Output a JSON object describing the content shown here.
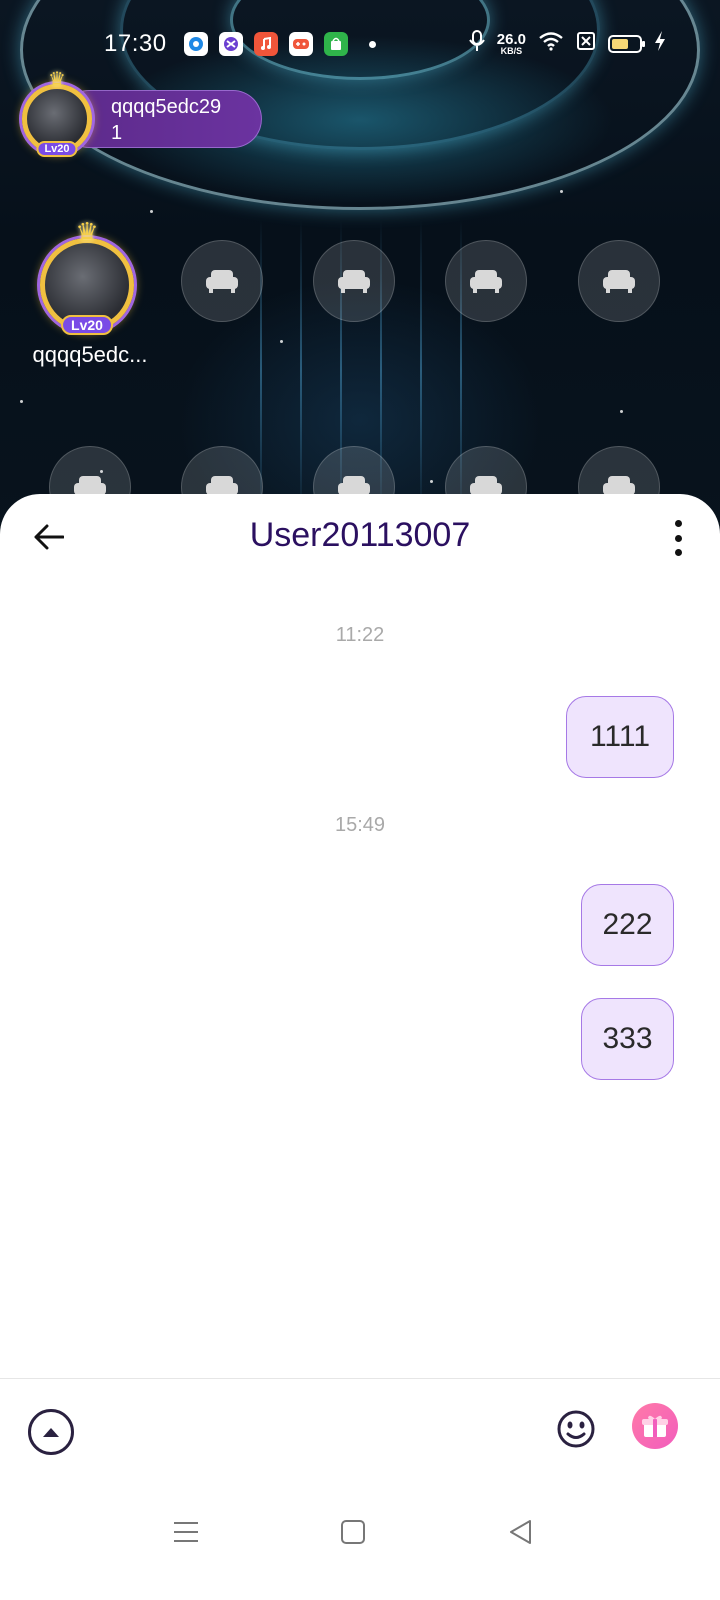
{
  "status_bar": {
    "time": "17:30",
    "net_speed_value": "26.0",
    "net_speed_unit": "KB/S",
    "app_icons": [
      "location-app-icon",
      "browser-app-icon",
      "music-app-icon",
      "game-app-icon",
      "store-app-icon"
    ],
    "system_icons": [
      "microphone-icon",
      "wifi-icon",
      "sim-off-icon",
      "battery-icon",
      "charging-icon"
    ]
  },
  "room": {
    "host_name": "qqqq5edc29",
    "host_count": "1",
    "host_level": "Lv20",
    "seat_owner_name": "qqqq5edc...",
    "seat_owner_level": "Lv20"
  },
  "chat": {
    "title": "User20113007",
    "messages": [
      {
        "timestamp": "11:22",
        "text": "1111"
      },
      {
        "timestamp": "15:49",
        "text": "222"
      },
      {
        "timestamp": "",
        "text": "333"
      }
    ]
  },
  "colors": {
    "accent_purple": "#6b33a0",
    "bubble_bg": "#efe4fd",
    "bubble_border": "#a679e6",
    "title_color": "#2b1060",
    "gift_pink": "#f25dbd"
  }
}
